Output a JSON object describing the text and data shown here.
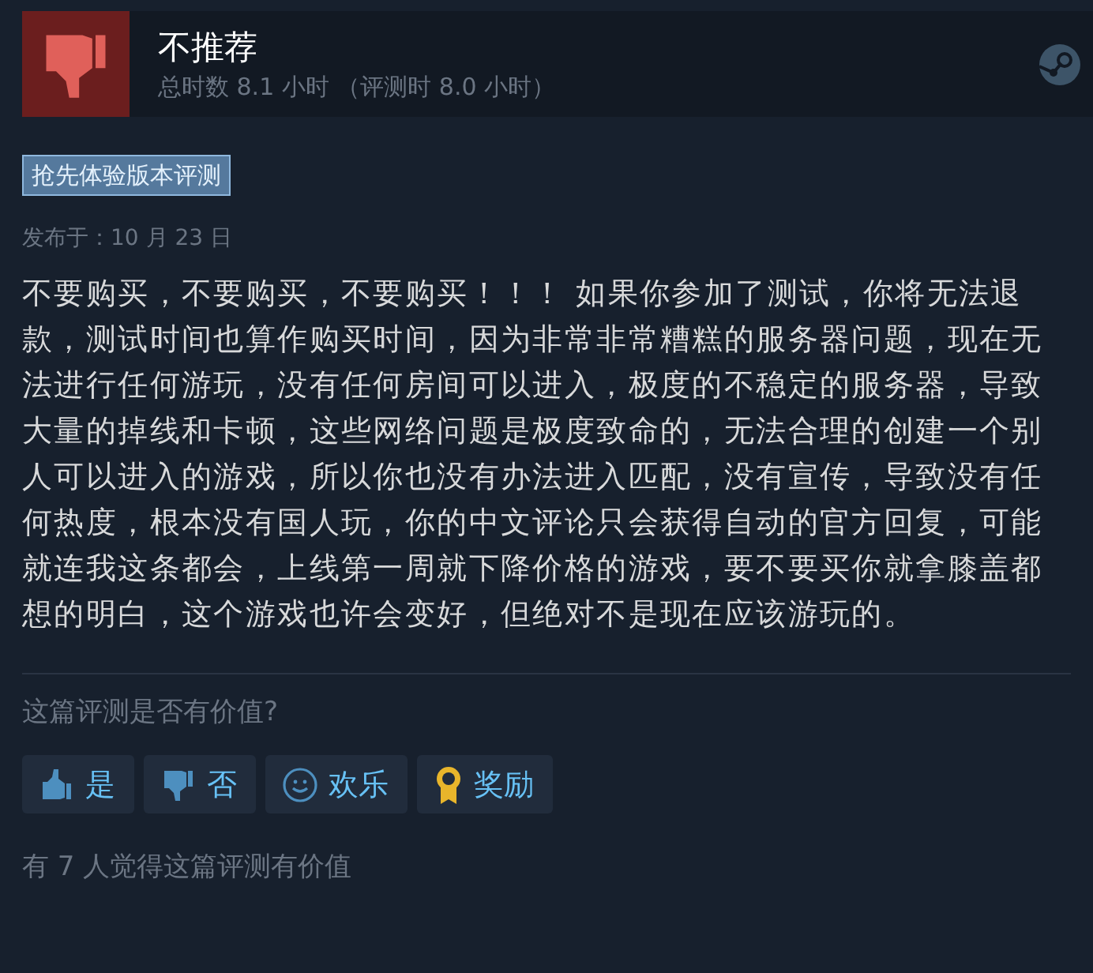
{
  "review": {
    "verdict": "不推荐",
    "recommended": false,
    "hours": "总时数 8.1 小时 （评测时 8.0 小时）"
  },
  "tag": "抢先体验版本评测",
  "posted": "发布于：10 月 23 日",
  "body": "不要购买，不要购买，不要购买！！！ 如果你参加了测试，你将无法退款，测试时间也算作购买时间，因为非常非常糟糕的服务器问题，现在无法进行任何游玩，没有任何房间可以进入，极度的不稳定的服务器，导致大量的掉线和卡顿，这些网络问题是极度致命的，无法合理的创建一个别人可以进入的游戏，所以你也没有办法进入匹配，没有宣传，导致没有任何热度，根本没有国人玩，你的中文评论只会获得自动的官方回复，可能就连我这条都会，上线第一周就下降价格的游戏，要不要买你就拿膝盖都想的明白，这个游戏也许会变好，但绝对不是现在应该游玩的。",
  "helpful_prompt": "这篇评测是否有价值?",
  "buttons": [
    {
      "kind": "up",
      "label": "是"
    },
    {
      "kind": "down",
      "label": "否"
    },
    {
      "kind": "funny",
      "label": "欢乐"
    },
    {
      "kind": "award",
      "label": "奖励"
    }
  ],
  "helpful_count": "有 7 人觉得这篇评测有价值"
}
